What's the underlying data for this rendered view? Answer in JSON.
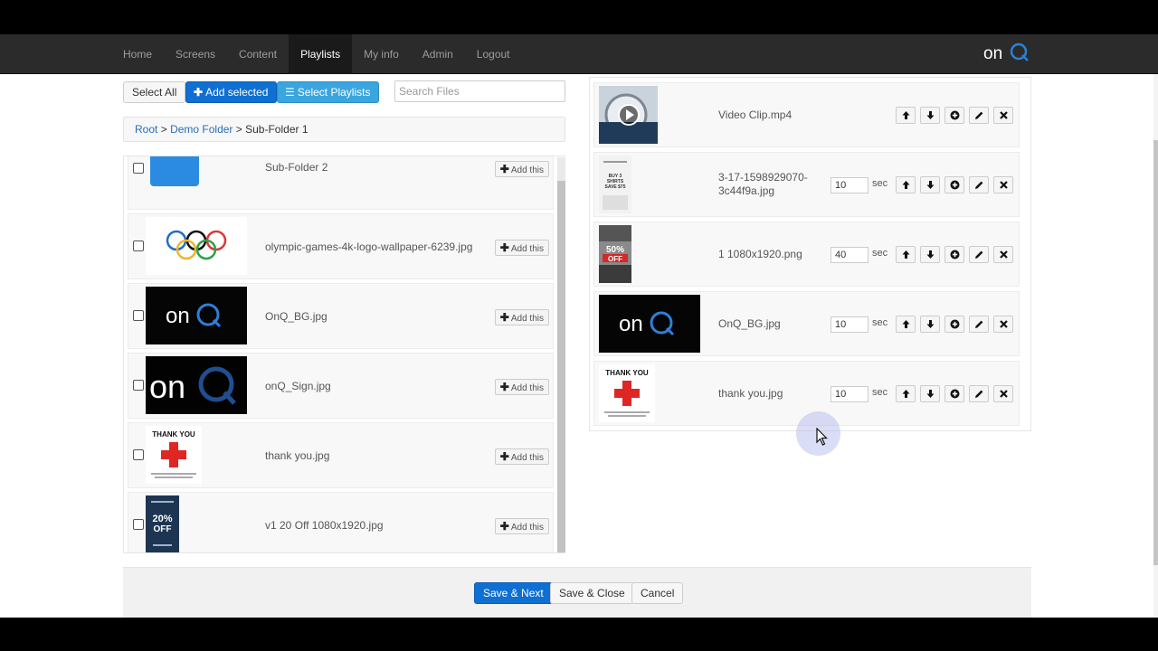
{
  "nav": {
    "items": [
      {
        "label": "Home",
        "active": false
      },
      {
        "label": "Screens",
        "active": false
      },
      {
        "label": "Content",
        "active": false
      },
      {
        "label": "Playlists",
        "active": true
      },
      {
        "label": "My info",
        "active": false
      },
      {
        "label": "Admin",
        "active": false
      },
      {
        "label": "Logout",
        "active": false
      }
    ],
    "logo_text": "onQ"
  },
  "toolbar": {
    "select_all": "Select All",
    "add_selected": "Add selected",
    "select_playlists": "Select Playlists",
    "search_placeholder": "Search Files"
  },
  "breadcrumb": {
    "root": "Root",
    "sep": ">",
    "folder": "Demo Folder",
    "current": "Sub-Folder 1"
  },
  "files": [
    {
      "name": "Sub-Folder 2",
      "thumb": "folder-icon",
      "add": "Add this"
    },
    {
      "name": "olympic-games-4k-logo-wallpaper-6239.jpg",
      "thumb": "olympic-rings",
      "add": "Add this"
    },
    {
      "name": "OnQ_BG.jpg",
      "thumb": "onq-logo-dark",
      "add": "Add this"
    },
    {
      "name": "onQ_Sign.jpg",
      "thumb": "onq-sign",
      "add": "Add this"
    },
    {
      "name": "thank you.jpg",
      "thumb": "thank-you-cross",
      "add": "Add this"
    },
    {
      "name": "v1 20 Off 1080x1920.jpg",
      "thumb": "20-off-poster",
      "add": "Add this"
    }
  ],
  "playlist": [
    {
      "name": "Video Clip.mp4",
      "duration": null,
      "thumb": "video-watch"
    },
    {
      "name": "3-17-1598929070-3c44f9a.jpg",
      "duration": "10",
      "thumb": "shirts-poster"
    },
    {
      "name": "1 1080x1920.png",
      "duration": "40",
      "thumb": "50-off-poster"
    },
    {
      "name": "OnQ_BG.jpg",
      "duration": "10",
      "thumb": "onq-logo-dark"
    },
    {
      "name": "thank you.jpg",
      "duration": "10",
      "thumb": "thank-you-cross"
    }
  ],
  "sec_label": "sec",
  "thumb_text": {
    "thank_you": "THANK YOU",
    "off20_pct": "20%",
    "off": "OFF",
    "off50_pct": "50%",
    "shirts": "BUY 3\nSHIRTS\nSAVE $75"
  },
  "footer": {
    "save_next": "Save & Next",
    "save_close": "Save & Close",
    "cancel": "Cancel"
  },
  "colors": {
    "primary": "#0f6fd2",
    "info": "#3aa5de",
    "navbar": "#2b2b2b",
    "link": "#2a6db5"
  }
}
